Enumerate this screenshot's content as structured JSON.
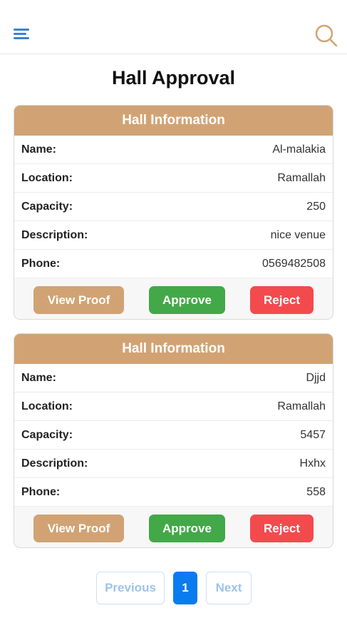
{
  "header": {
    "menu_icon": "hamburger-menu-icon",
    "search_icon": "search-icon"
  },
  "page": {
    "title": "Hall Approval"
  },
  "colors": {
    "accent": "#d1a374",
    "approve": "#43a848",
    "reject": "#f34a4e",
    "primary": "#0a7cf0",
    "menu": "#3b82d6"
  },
  "halls": [
    {
      "header": "Hall Information",
      "fields": [
        {
          "label": "Name:",
          "value": "Al-malakia"
        },
        {
          "label": "Location:",
          "value": "Ramallah"
        },
        {
          "label": "Capacity:",
          "value": "250"
        },
        {
          "label": "Description:",
          "value": "nice venue"
        },
        {
          "label": "Phone:",
          "value": "0569482508"
        }
      ],
      "buttons": {
        "view_proof": "View Proof",
        "approve": "Approve",
        "reject": "Reject"
      }
    },
    {
      "header": "Hall Information",
      "fields": [
        {
          "label": "Name:",
          "value": "Djjd"
        },
        {
          "label": "Location:",
          "value": "Ramallah"
        },
        {
          "label": "Capacity:",
          "value": "5457"
        },
        {
          "label": "Description:",
          "value": "Hxhx"
        },
        {
          "label": "Phone:",
          "value": "558"
        }
      ],
      "buttons": {
        "view_proof": "View Proof",
        "approve": "Approve",
        "reject": "Reject"
      }
    }
  ],
  "pagination": {
    "previous": "Previous",
    "current": "1",
    "next": "Next"
  }
}
